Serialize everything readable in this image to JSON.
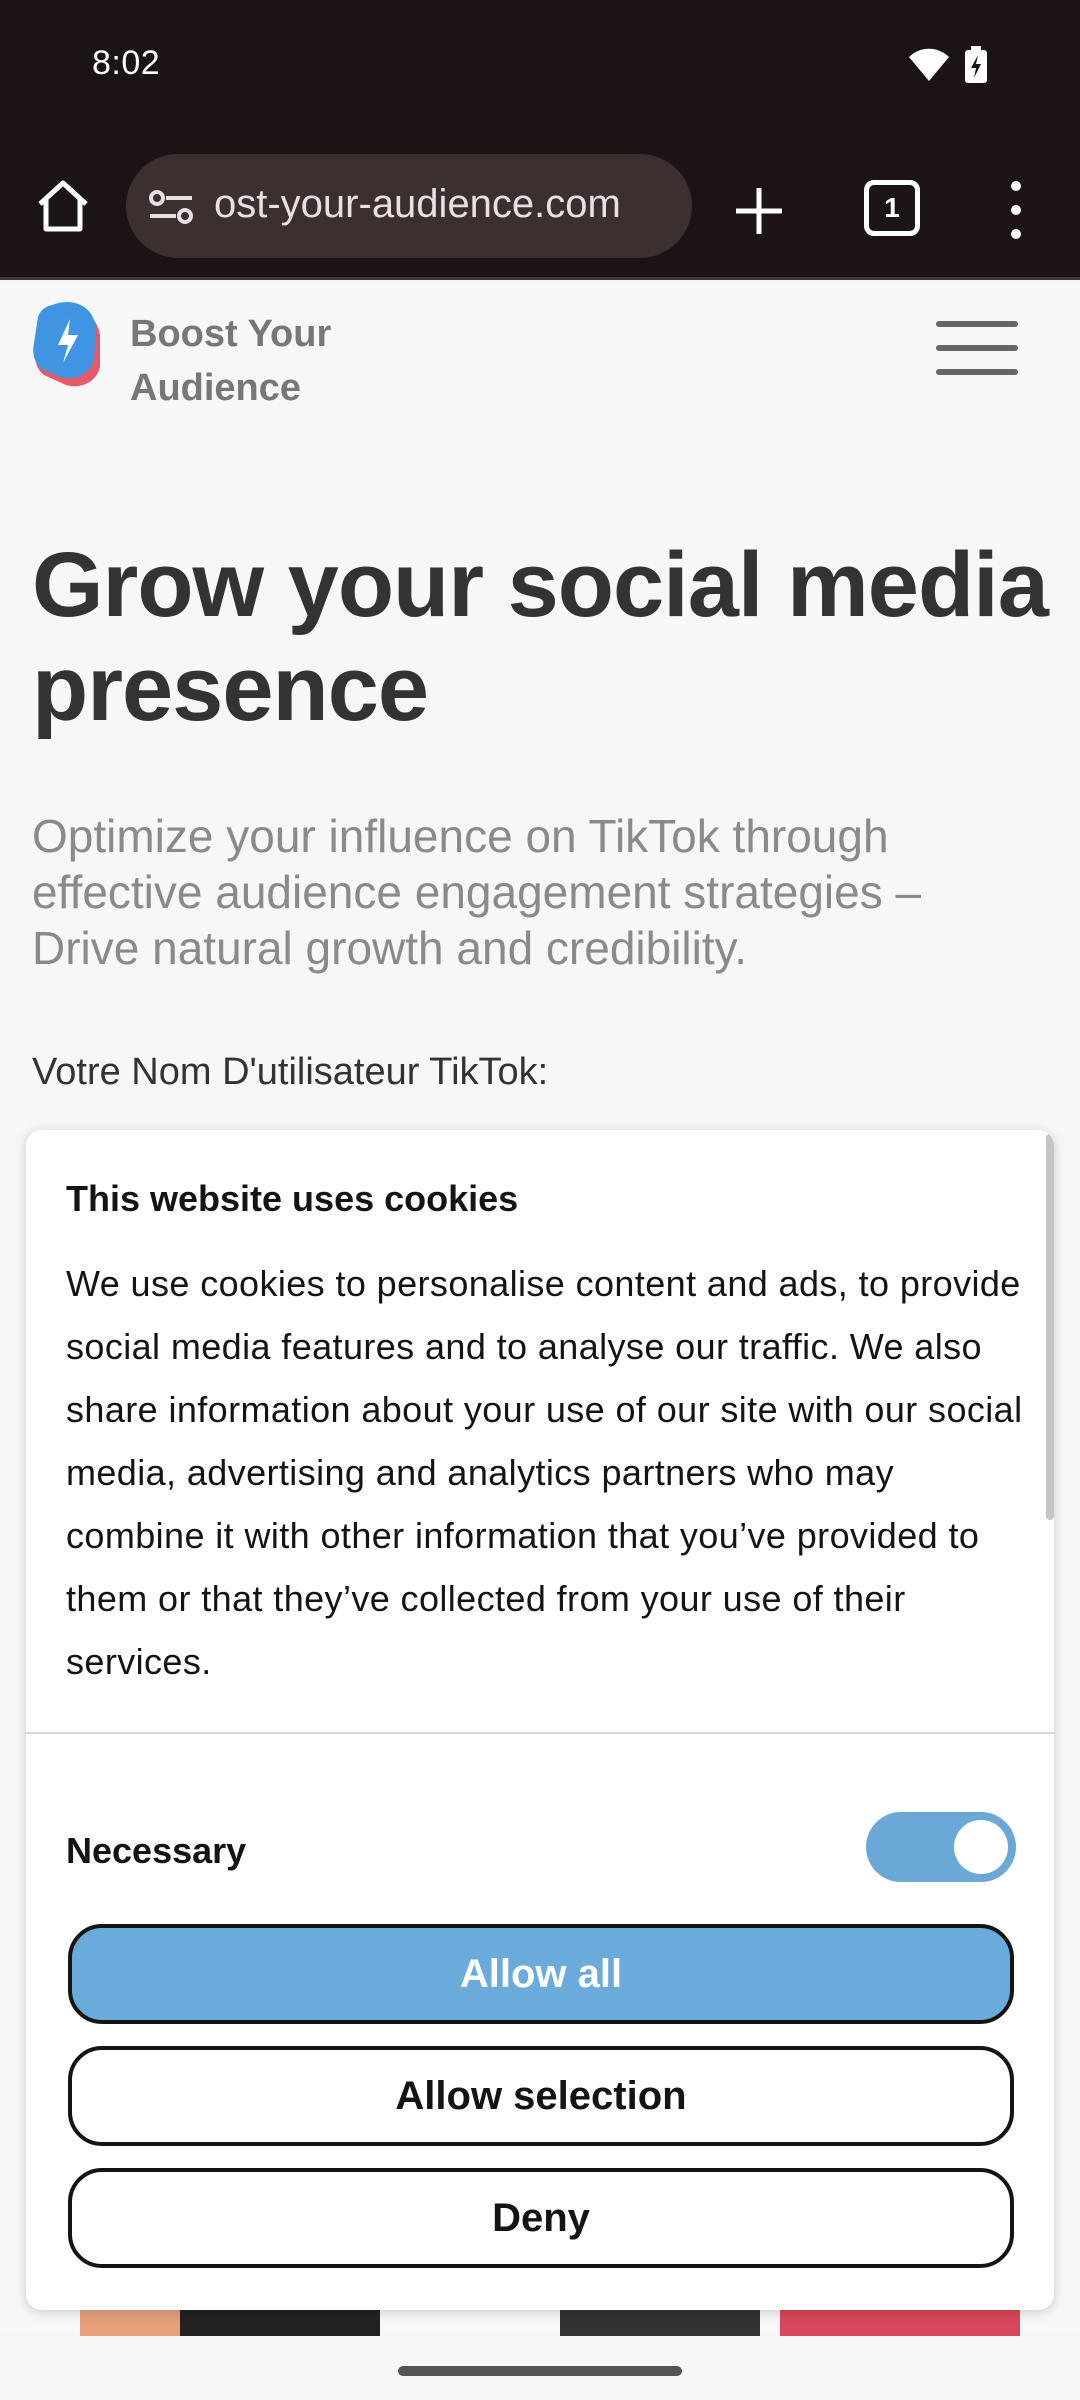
{
  "status_bar": {
    "time": "8:02",
    "icons": [
      "wifi-icon",
      "battery-charging-icon"
    ]
  },
  "browser": {
    "url": "ost-your-audience.com",
    "tab_count": "1",
    "icons": [
      "home-icon",
      "site-settings-icon",
      "plus-icon",
      "tabs-icon",
      "more-vert-icon"
    ]
  },
  "site": {
    "logo_text": "Boost Your Audience",
    "headline": "Grow your social media presence",
    "subtext": "Optimize your influence on TikTok through effective audience engagement strategies – Drive natural growth and credibility.",
    "username_label": "Votre Nom D'utilisateur TikTok:"
  },
  "cookie_banner": {
    "title": "This website uses cookies",
    "body": "We use cookies to personalise content and ads, to provide social media features and to analyse our traffic. We also share information about your use of our site with our social media, advertising and analytics partners who may combine it with other information that you’ve provided to them or that they’ve collected from your use of their services.",
    "necessary_label": "Necessary",
    "necessary_enabled": true,
    "buttons": {
      "allow_all": "Allow all",
      "allow_selection": "Allow selection",
      "deny": "Deny"
    }
  },
  "colors": {
    "accent": "#6aabdb",
    "browser_bar": "#1c1314",
    "headline": "#333333"
  }
}
